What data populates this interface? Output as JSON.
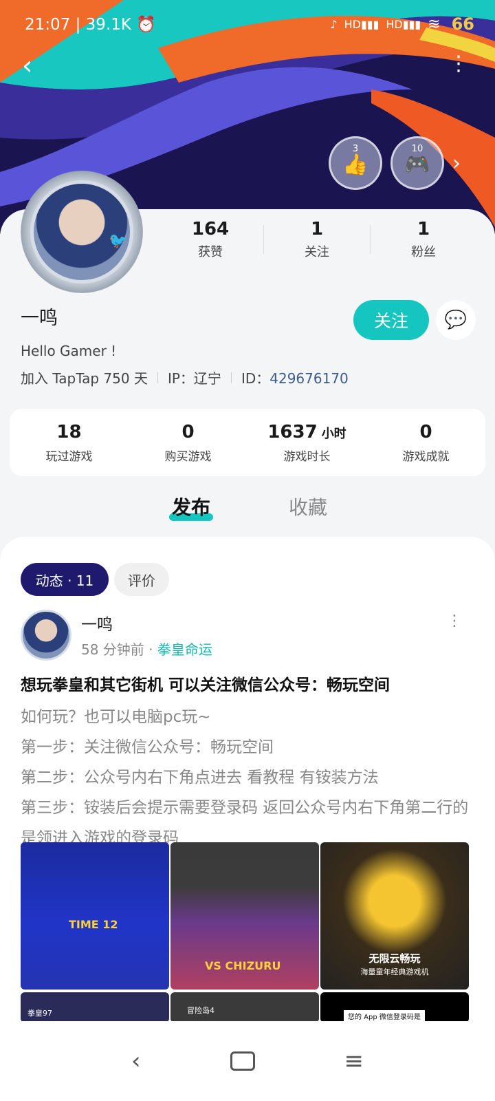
{
  "status": {
    "time": "21:07",
    "speed": "39.1K",
    "network": "HD",
    "battery": "66"
  },
  "badges": [
    {
      "count": "3"
    },
    {
      "count": "10"
    }
  ],
  "profile": {
    "name": "一鸣",
    "stats": [
      {
        "value": "164",
        "label": "获赞"
      },
      {
        "value": "1",
        "label": "关注"
      },
      {
        "value": "1",
        "label": "粉丝"
      }
    ],
    "follow_label": "关注",
    "bio": "Hello Gamer !",
    "joined": "加入 TapTap 750 天",
    "ip": "IP：辽宁",
    "id_label": "ID：",
    "id_value": "429676170"
  },
  "summary": [
    {
      "value": "18",
      "unit": "",
      "label": "玩过游戏"
    },
    {
      "value": "0",
      "unit": "",
      "label": "购买游戏"
    },
    {
      "value": "1637",
      "unit": "小时",
      "label": "游戏时长"
    },
    {
      "value": "0",
      "unit": "",
      "label": "游戏成就"
    }
  ],
  "tabs": {
    "active": "发布",
    "other": "收藏"
  },
  "filters": {
    "dynamic": "动态 · 11",
    "review": "评价"
  },
  "post": {
    "author": "一鸣",
    "time": "58 分钟前",
    "dot": "·",
    "game": "拳皇命运",
    "title": "想玩拳皇和其它街机 可以关注微信公众号：畅玩空间",
    "lines": [
      "如何玩？也可以电脑pc玩~",
      "第一步：关注微信公众号：畅玩空间",
      "第二步：公众号内右下角点进去 看教程 有铵装方法",
      "第三步：铵装后会提示需要登录码 返回公众号内右下角第二行的是领进入游戏的登录码"
    ],
    "images": [
      {
        "caption": "TIME 12"
      },
      {
        "caption": "VS CHIZURU"
      },
      {
        "caption": "无限云畅玩",
        "sub": "海量童年经典游戏机"
      }
    ],
    "more_images": [
      {
        "caption": "拳皇97"
      },
      {
        "caption": "冒险岛4"
      },
      {
        "caption": "您的 App 微信登录码是"
      }
    ]
  }
}
